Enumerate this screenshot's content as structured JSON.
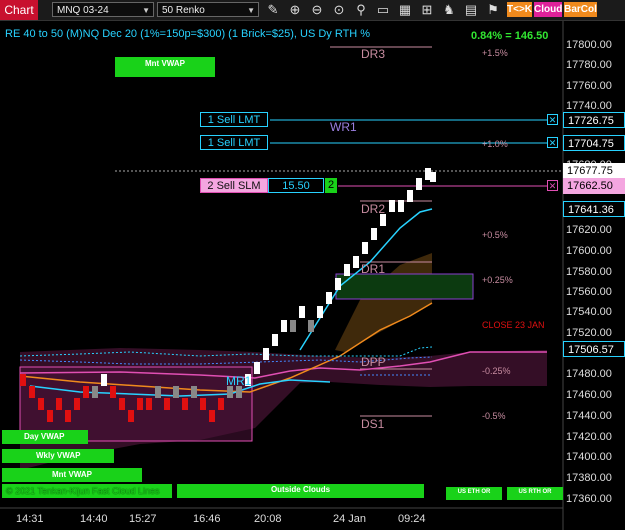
{
  "toolbar": {
    "title": "Chart",
    "instrument": "MNQ 03-24",
    "bar_type": "50 Renko",
    "icons": [
      "pencil-icon",
      "zoom-in-icon",
      "zoom-out-icon",
      "zoom-reset-icon",
      "drawing-tools-icon",
      "comment-icon",
      "properties-icon",
      "scroll-lock-icon",
      "strategy-icon",
      "attachments-icon"
    ],
    "btn_tk": "T<>K",
    "btn_cloud": "Cloud",
    "btn_barcol": "BarCol"
  },
  "header": {
    "indicator_text": "RE 40 to 50 (M)NQ Dec 20 (1%=150p=$300) (1 Brick=$25), US Dy RTH %",
    "pnl": "0.84% = 146.50"
  },
  "levels": {
    "dr3": "DR3",
    "wr1": "WR1",
    "dr2": "DR2",
    "dr1": "DR1",
    "dpp": "DPP",
    "mr1": "MR1",
    "ds1": "DS1",
    "p15": "+1.5%",
    "p10": "+1.0%",
    "p05": "+0.5%",
    "p025": "+0.25%",
    "close": "CLOSE 23 JAN",
    "m025": "-0.25%",
    "m05": "-0.5%"
  },
  "orders": {
    "sell1_a": "1 Sell LMT",
    "sell1_b": "1 Sell LMT",
    "sell2": "2 Sell SLM",
    "sell2_offset": "15.50",
    "sell2_qty": "2"
  },
  "price_boxes": {
    "p1": "17726.75",
    "p2": "17704.75",
    "p3": "17677.75",
    "p4": "17662.50",
    "p5": "17641.36",
    "p6": "17506.57"
  },
  "yaxis": [
    "17800.00",
    "17780.00",
    "17760.00",
    "17740.00",
    "17720.00",
    "17700.00",
    "17680.00",
    "17660.00",
    "17640.00",
    "17620.00",
    "17600.00",
    "17580.00",
    "17560.00",
    "17540.00",
    "17520.00",
    "17500.00",
    "17480.00",
    "17460.00",
    "17440.00",
    "17420.00",
    "17400.00",
    "17380.00",
    "17360.00"
  ],
  "xaxis": [
    "14:31",
    "14:40",
    "15:27",
    "16:46",
    "20:08",
    "24 Jan",
    "09:24"
  ],
  "buttons": {
    "mnt_vwap_top": "Mnt VWAP",
    "day_vwap": "Day VWAP",
    "wkly_vwap": "Wkly VWAP",
    "mnt_vwap": "Mnt VWAP",
    "outside_clouds": "Outside Clouds",
    "us_eth_or": "US ETH OR",
    "us_rth_or": "US RTH OR"
  },
  "footer_text": "© 2021 Tenkan-Kijun Fast Cloud Lines",
  "colors": {
    "accent_red": "#c8102e",
    "cyan": "#28d2ff",
    "green": "#19d219",
    "magenta": "#e04fb3"
  }
}
